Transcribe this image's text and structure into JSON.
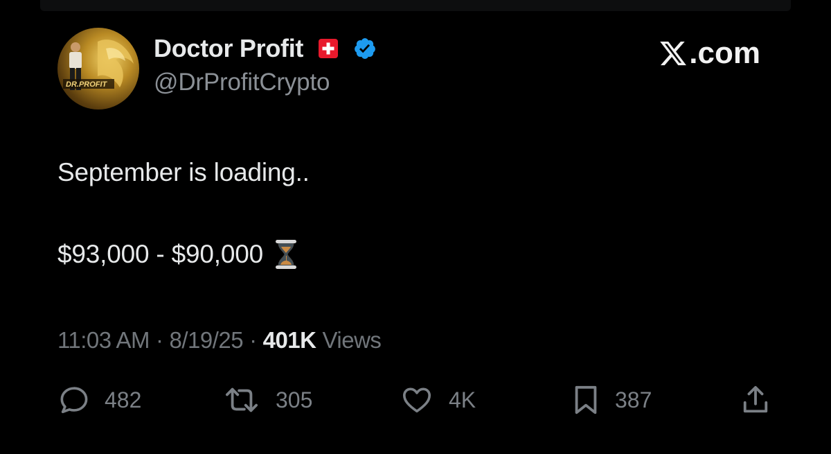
{
  "author": {
    "display_name": "Doctor Profit",
    "handle": "@DrProfitCrypto",
    "avatar_text": "DR.PROFIT"
  },
  "brand": {
    "label": ".com"
  },
  "tweet": {
    "line1": "September is loading..",
    "line2": "$93,000 - $90,000"
  },
  "meta": {
    "time": "11:03 AM",
    "separator": "·",
    "date": "8/19/25",
    "views_count": "401K",
    "views_label": "Views"
  },
  "actions": {
    "replies": "482",
    "reposts": "305",
    "likes": "4K",
    "bookmarks": "387"
  },
  "colors": {
    "background": "#000000",
    "text_primary": "#e7e9ea",
    "text_secondary": "#71767b",
    "verified": "#1d9bf0",
    "flag_red": "#e8192c"
  },
  "icons": [
    "swiss-flag-icon",
    "verified-badge-icon",
    "x-logo-icon",
    "hourglass-icon",
    "reply-icon",
    "retweet-icon",
    "heart-icon",
    "bookmark-icon",
    "share-icon"
  ]
}
